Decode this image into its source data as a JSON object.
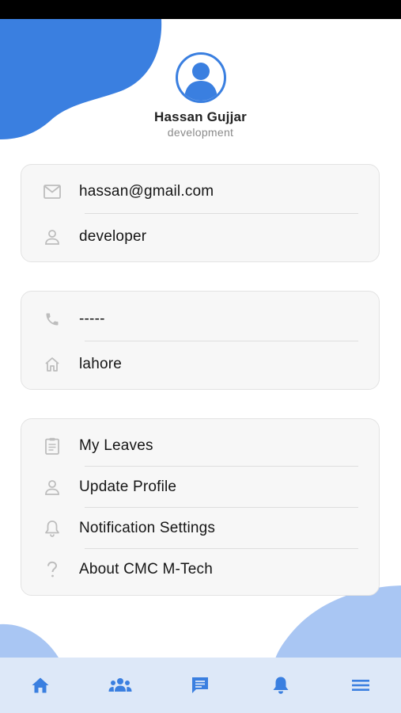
{
  "profile": {
    "name": "Hassan Gujjar",
    "role": "development"
  },
  "contact_card": {
    "email": "hassan@gmail.com",
    "designation": "developer"
  },
  "address_card": {
    "phone": "-----",
    "city": "lahore"
  },
  "menu": {
    "my_leaves": "My Leaves",
    "update_profile": "Update Profile",
    "notification_settings": "Notification Settings",
    "about": "About CMC M-Tech"
  },
  "bottom_nav": [
    "home-icon",
    "team-icon",
    "messages-icon",
    "bell-icon",
    "menu-icon"
  ],
  "colors": {
    "accent": "#3a7fe0",
    "blob_light": "#a9c6f3",
    "nav_background": "#dde8f8",
    "icon_muted": "#bdbdbd"
  }
}
